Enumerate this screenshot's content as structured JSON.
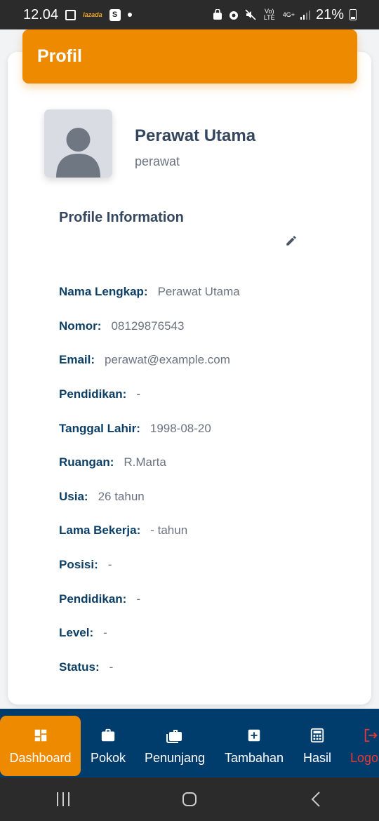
{
  "status_bar": {
    "time": "12.04",
    "shop_icon_text": "S",
    "lazada_text": "lazada",
    "volte_text": "Vo) LTE",
    "network_text": "4G+",
    "battery_percent": "21%"
  },
  "header": {
    "title": "Profil"
  },
  "profile": {
    "name": "Perawat Utama",
    "role": "perawat",
    "section_title": "Profile Information"
  },
  "info": [
    {
      "label": "Nama Lengkap:",
      "value": "Perawat Utama"
    },
    {
      "label": "Nomor:",
      "value": "08129876543"
    },
    {
      "label": "Email:",
      "value": "perawat@example.com"
    },
    {
      "label": "Pendidikan:",
      "value": "-"
    },
    {
      "label": "Tanggal Lahir:",
      "value": "1998-08-20"
    },
    {
      "label": "Ruangan:",
      "value": "R.Marta"
    },
    {
      "label": "Usia:",
      "value": "26 tahun"
    },
    {
      "label": "Lama Bekerja:",
      "value": "- tahun"
    },
    {
      "label": "Posisi:",
      "value": "-"
    },
    {
      "label": "Pendidikan:",
      "value": "-"
    },
    {
      "label": "Level:",
      "value": "-"
    },
    {
      "label": "Status:",
      "value": "-"
    }
  ],
  "nav": {
    "items": [
      {
        "label": "Dashboard",
        "icon": "dashboard-icon",
        "active": true
      },
      {
        "label": "Pokok",
        "icon": "briefcase-icon"
      },
      {
        "label": "Penunjang",
        "icon": "briefcases-icon"
      },
      {
        "label": "Tambahan",
        "icon": "plus-box-icon"
      },
      {
        "label": "Hasil",
        "icon": "calculator-icon"
      },
      {
        "label": "Logout",
        "icon": "logout-icon"
      }
    ]
  },
  "colors": {
    "accent": "#ed8a00",
    "nav_background": "#003c6c",
    "label_color": "#0d3f66",
    "logout_color": "#e53935"
  }
}
